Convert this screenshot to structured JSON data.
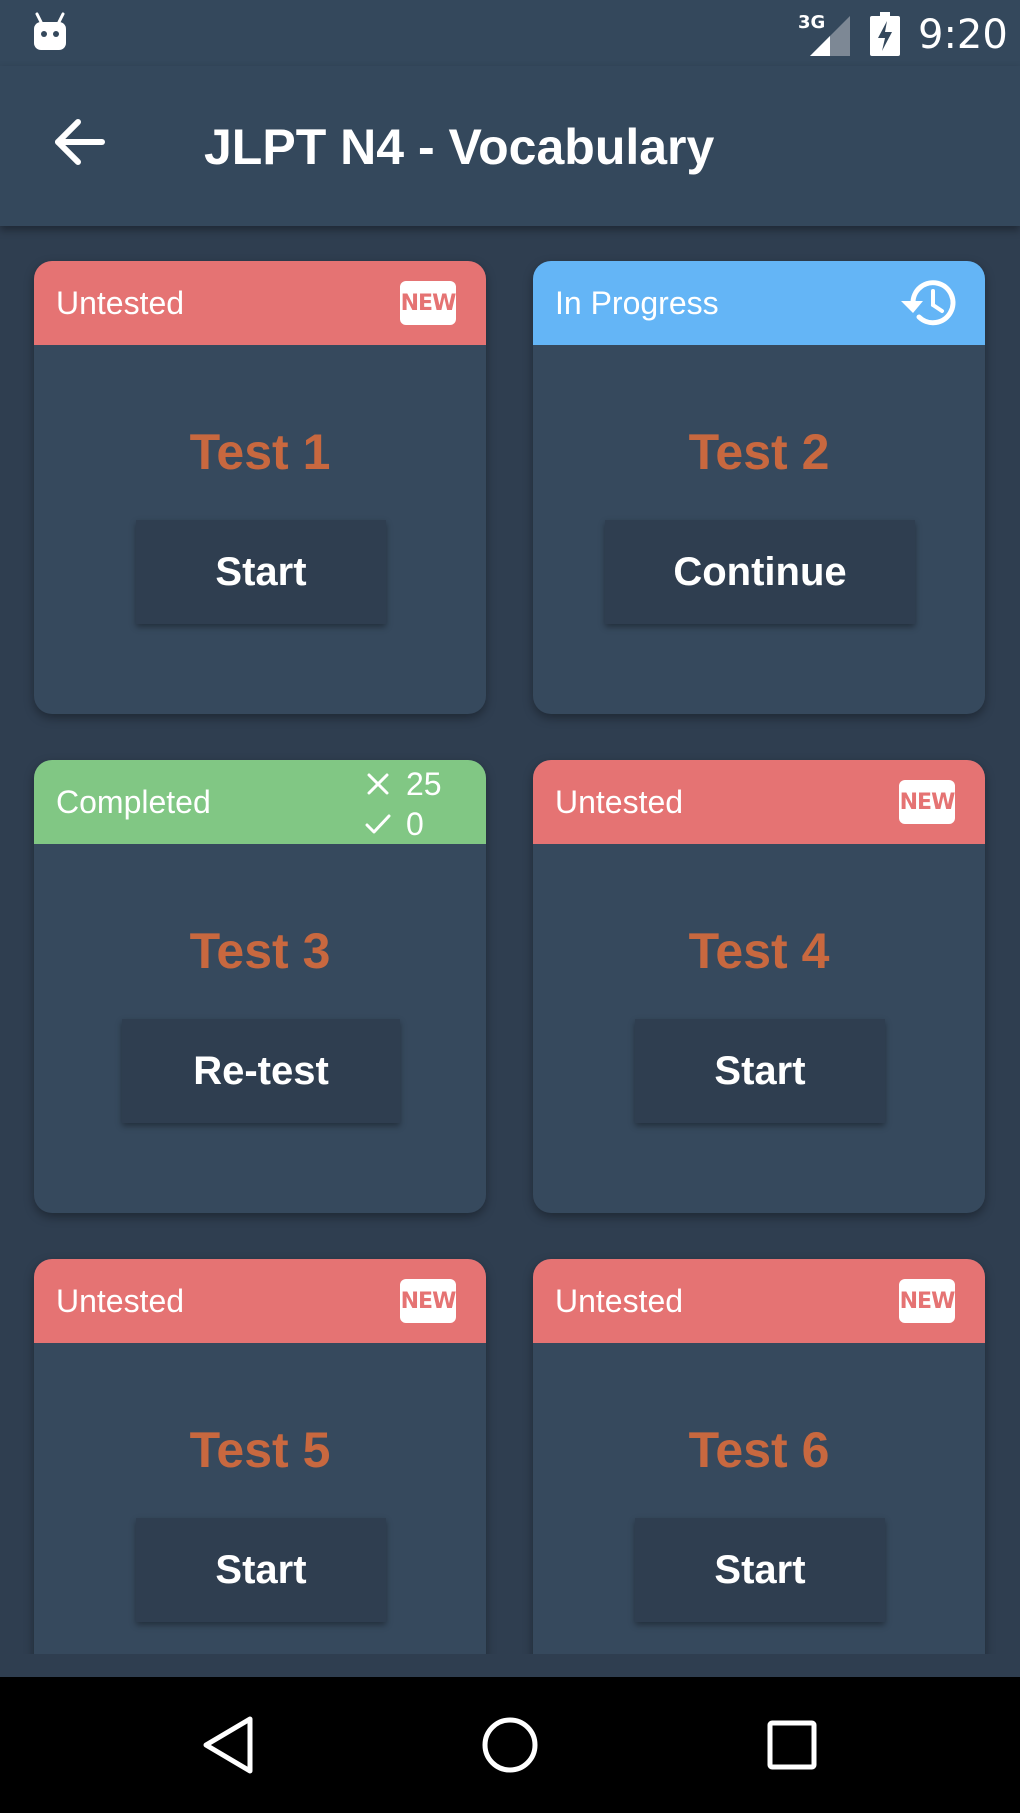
{
  "status_bar": {
    "network": "3G",
    "time": "9:20"
  },
  "app_bar": {
    "title": "JLPT N4 - Vocabulary"
  },
  "icons": {
    "back": "arrow-left-icon",
    "new": "new-badge-icon",
    "history": "history-icon",
    "wrong": "close-icon",
    "right": "check-icon"
  },
  "colors": {
    "untested": "#e57373",
    "in_progress": "#64b5f6",
    "completed": "#81c784",
    "test_title": "#c8683f"
  },
  "tests": [
    {
      "status": "Untested",
      "badge": "NEW",
      "title": "Test 1",
      "action": "Start"
    },
    {
      "status": "In Progress",
      "title": "Test 2",
      "action": "Continue"
    },
    {
      "status": "Completed",
      "wrong_count": "25",
      "right_count": "0",
      "title": "Test 3",
      "action": "Re-test"
    },
    {
      "status": "Untested",
      "badge": "NEW",
      "title": "Test 4",
      "action": "Start"
    },
    {
      "status": "Untested",
      "badge": "NEW",
      "title": "Test 5",
      "action": "Start"
    },
    {
      "status": "Untested",
      "badge": "NEW",
      "title": "Test 6",
      "action": "Start"
    }
  ]
}
